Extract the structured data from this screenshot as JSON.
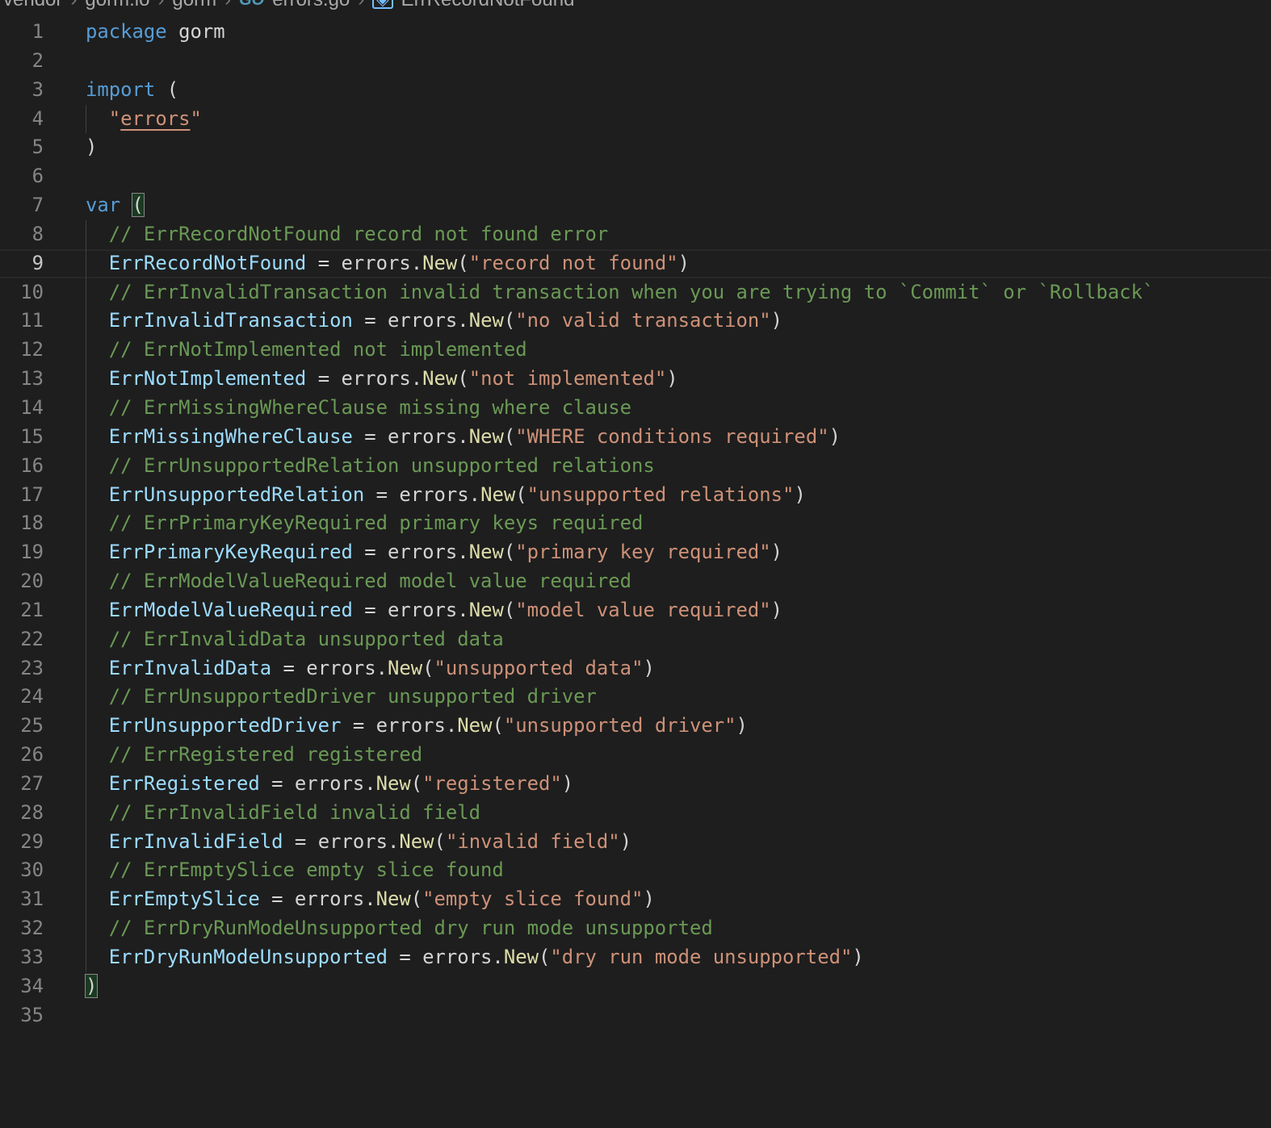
{
  "breadcrumb": {
    "items": [
      "vendor",
      "gorm.io",
      "gorm",
      "errors.go",
      "ErrRecordNotFound"
    ],
    "file_icon": "go-file-icon",
    "symbol_icon": "variable-symbol-icon"
  },
  "editor": {
    "current_line": 9,
    "colors": {
      "keyword": "#569cd6",
      "variable": "#9cdcfe",
      "function": "#dcdcaa",
      "string": "#ce9178",
      "comment": "#6a9955",
      "text": "#d4d4d4",
      "background": "#1e1e1e"
    },
    "lines": [
      {
        "n": "1",
        "indent": 0,
        "tokens": [
          [
            "kw",
            "package"
          ],
          [
            "pl",
            " gorm"
          ]
        ]
      },
      {
        "n": "2",
        "indent": 0,
        "tokens": []
      },
      {
        "n": "3",
        "indent": 0,
        "tokens": [
          [
            "kw",
            "import"
          ],
          [
            "pl",
            " ("
          ]
        ]
      },
      {
        "n": "4",
        "indent": 1,
        "tokens": [
          [
            "str",
            "\""
          ],
          [
            "str ul",
            "errors"
          ],
          [
            "str",
            "\""
          ]
        ]
      },
      {
        "n": "5",
        "indent": 0,
        "tokens": [
          [
            "pl",
            ")"
          ]
        ]
      },
      {
        "n": "6",
        "indent": 0,
        "tokens": []
      },
      {
        "n": "7",
        "indent": 0,
        "tokens": [
          [
            "kw",
            "var"
          ],
          [
            "pl",
            " "
          ],
          [
            "pl bm",
            "("
          ]
        ]
      },
      {
        "n": "8",
        "indent": 1,
        "tokens": [
          [
            "cm",
            "// ErrRecordNotFound record not found error"
          ]
        ]
      },
      {
        "n": "9",
        "indent": 1,
        "tokens": [
          [
            "var",
            "ErrRecordNotFound"
          ],
          [
            "pl",
            " = errors."
          ],
          [
            "fn",
            "New"
          ],
          [
            "pl",
            "("
          ],
          [
            "str",
            "\"record not found\""
          ],
          [
            "pl",
            ")"
          ]
        ]
      },
      {
        "n": "10",
        "indent": 1,
        "tokens": [
          [
            "cm",
            "// ErrInvalidTransaction invalid transaction when you are trying to `Commit` or `Rollback`"
          ]
        ]
      },
      {
        "n": "11",
        "indent": 1,
        "tokens": [
          [
            "var",
            "ErrInvalidTransaction"
          ],
          [
            "pl",
            " = errors."
          ],
          [
            "fn",
            "New"
          ],
          [
            "pl",
            "("
          ],
          [
            "str",
            "\"no valid transaction\""
          ],
          [
            "pl",
            ")"
          ]
        ]
      },
      {
        "n": "12",
        "indent": 1,
        "tokens": [
          [
            "cm",
            "// ErrNotImplemented not implemented"
          ]
        ]
      },
      {
        "n": "13",
        "indent": 1,
        "tokens": [
          [
            "var",
            "ErrNotImplemented"
          ],
          [
            "pl",
            " = errors."
          ],
          [
            "fn",
            "New"
          ],
          [
            "pl",
            "("
          ],
          [
            "str",
            "\"not implemented\""
          ],
          [
            "pl",
            ")"
          ]
        ]
      },
      {
        "n": "14",
        "indent": 1,
        "tokens": [
          [
            "cm",
            "// ErrMissingWhereClause missing where clause"
          ]
        ]
      },
      {
        "n": "15",
        "indent": 1,
        "tokens": [
          [
            "var",
            "ErrMissingWhereClause"
          ],
          [
            "pl",
            " = errors."
          ],
          [
            "fn",
            "New"
          ],
          [
            "pl",
            "("
          ],
          [
            "str",
            "\"WHERE conditions required\""
          ],
          [
            "pl",
            ")"
          ]
        ]
      },
      {
        "n": "16",
        "indent": 1,
        "tokens": [
          [
            "cm",
            "// ErrUnsupportedRelation unsupported relations"
          ]
        ]
      },
      {
        "n": "17",
        "indent": 1,
        "tokens": [
          [
            "var",
            "ErrUnsupportedRelation"
          ],
          [
            "pl",
            " = errors."
          ],
          [
            "fn",
            "New"
          ],
          [
            "pl",
            "("
          ],
          [
            "str",
            "\"unsupported relations\""
          ],
          [
            "pl",
            ")"
          ]
        ]
      },
      {
        "n": "18",
        "indent": 1,
        "tokens": [
          [
            "cm",
            "// ErrPrimaryKeyRequired primary keys required"
          ]
        ]
      },
      {
        "n": "19",
        "indent": 1,
        "tokens": [
          [
            "var",
            "ErrPrimaryKeyRequired"
          ],
          [
            "pl",
            " = errors."
          ],
          [
            "fn",
            "New"
          ],
          [
            "pl",
            "("
          ],
          [
            "str",
            "\"primary key required\""
          ],
          [
            "pl",
            ")"
          ]
        ]
      },
      {
        "n": "20",
        "indent": 1,
        "tokens": [
          [
            "cm",
            "// ErrModelValueRequired model value required"
          ]
        ]
      },
      {
        "n": "21",
        "indent": 1,
        "tokens": [
          [
            "var",
            "ErrModelValueRequired"
          ],
          [
            "pl",
            " = errors."
          ],
          [
            "fn",
            "New"
          ],
          [
            "pl",
            "("
          ],
          [
            "str",
            "\"model value required\""
          ],
          [
            "pl",
            ")"
          ]
        ]
      },
      {
        "n": "22",
        "indent": 1,
        "tokens": [
          [
            "cm",
            "// ErrInvalidData unsupported data"
          ]
        ]
      },
      {
        "n": "23",
        "indent": 1,
        "tokens": [
          [
            "var",
            "ErrInvalidData"
          ],
          [
            "pl",
            " = errors."
          ],
          [
            "fn",
            "New"
          ],
          [
            "pl",
            "("
          ],
          [
            "str",
            "\"unsupported data\""
          ],
          [
            "pl",
            ")"
          ]
        ]
      },
      {
        "n": "24",
        "indent": 1,
        "tokens": [
          [
            "cm",
            "// ErrUnsupportedDriver unsupported driver"
          ]
        ]
      },
      {
        "n": "25",
        "indent": 1,
        "tokens": [
          [
            "var",
            "ErrUnsupportedDriver"
          ],
          [
            "pl",
            " = errors."
          ],
          [
            "fn",
            "New"
          ],
          [
            "pl",
            "("
          ],
          [
            "str",
            "\"unsupported driver\""
          ],
          [
            "pl",
            ")"
          ]
        ]
      },
      {
        "n": "26",
        "indent": 1,
        "tokens": [
          [
            "cm",
            "// ErrRegistered registered"
          ]
        ]
      },
      {
        "n": "27",
        "indent": 1,
        "tokens": [
          [
            "var",
            "ErrRegistered"
          ],
          [
            "pl",
            " = errors."
          ],
          [
            "fn",
            "New"
          ],
          [
            "pl",
            "("
          ],
          [
            "str",
            "\"registered\""
          ],
          [
            "pl",
            ")"
          ]
        ]
      },
      {
        "n": "28",
        "indent": 1,
        "tokens": [
          [
            "cm",
            "// ErrInvalidField invalid field"
          ]
        ]
      },
      {
        "n": "29",
        "indent": 1,
        "tokens": [
          [
            "var",
            "ErrInvalidField"
          ],
          [
            "pl",
            " = errors."
          ],
          [
            "fn",
            "New"
          ],
          [
            "pl",
            "("
          ],
          [
            "str",
            "\"invalid field\""
          ],
          [
            "pl",
            ")"
          ]
        ]
      },
      {
        "n": "30",
        "indent": 1,
        "tokens": [
          [
            "cm",
            "// ErrEmptySlice empty slice found"
          ]
        ]
      },
      {
        "n": "31",
        "indent": 1,
        "tokens": [
          [
            "var",
            "ErrEmptySlice"
          ],
          [
            "pl",
            " = errors."
          ],
          [
            "fn",
            "New"
          ],
          [
            "pl",
            "("
          ],
          [
            "str",
            "\"empty slice found\""
          ],
          [
            "pl",
            ")"
          ]
        ]
      },
      {
        "n": "32",
        "indent": 1,
        "tokens": [
          [
            "cm",
            "// ErrDryRunModeUnsupported dry run mode unsupported"
          ]
        ]
      },
      {
        "n": "33",
        "indent": 1,
        "tokens": [
          [
            "var",
            "ErrDryRunModeUnsupported"
          ],
          [
            "pl",
            " = errors."
          ],
          [
            "fn",
            "New"
          ],
          [
            "pl",
            "("
          ],
          [
            "str",
            "\"dry run mode unsupported\""
          ],
          [
            "pl",
            ")"
          ]
        ]
      },
      {
        "n": "34",
        "indent": 0,
        "tokens": [
          [
            "pl bm",
            ")"
          ]
        ]
      },
      {
        "n": "35",
        "indent": 0,
        "tokens": []
      }
    ]
  }
}
